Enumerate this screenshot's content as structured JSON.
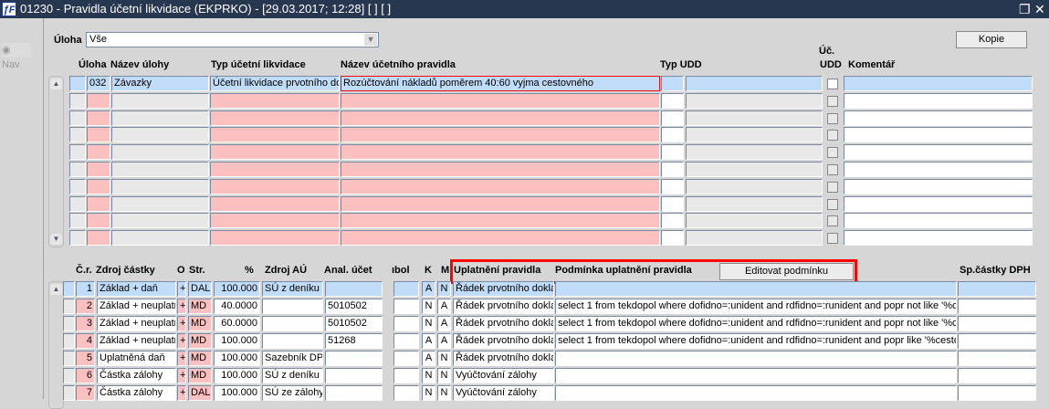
{
  "window": {
    "title": "01230 - Pravidla účetní likvidace (EKPRKO) - [29.03.2017; 12:28]  [ ] [ ]",
    "logo": "TF",
    "restore_icon": "restore-icon",
    "close_icon": "close-icon"
  },
  "nav": {
    "label": "Nav"
  },
  "filter": {
    "label": "Úloha",
    "value": "Vše"
  },
  "kopie_button": "Kopie",
  "top_grid": {
    "headers": {
      "uloha": "Úloha",
      "nazev_ulohy": "Název úlohy",
      "typ": "Typ účetní likvidace",
      "nazev_pravidla": "Název účetního pravidla",
      "typ_udd": "Typ UDD",
      "uc_udd_1": "Úč.",
      "uc_udd_2": "UDD",
      "komentar": "Komentář"
    },
    "rows": [
      {
        "uloha": "032",
        "nazev_ulohy": "Závazky",
        "typ": "Účetní likvidace prvotního do",
        "nazev_pravidla": "Rozúčtování nákladů poměrem 40:60 vyjma cestovného",
        "typ_udd": "",
        "typ_udd_name": "",
        "uc_udd": false,
        "komentar": ""
      }
    ],
    "empty_rows": 9
  },
  "bottom_grid": {
    "headers": {
      "cr": "Č.r.",
      "zdroj": "Zdroj částky",
      "o": "O",
      "str": "Str.",
      "pct": "%",
      "zdroj_au": "Zdroj AÚ",
      "anal": "Anal. účet",
      "symbol": "ıbol",
      "k": "K",
      "m": "M",
      "uplatneni": "Uplatnění pravidla",
      "podminka": "Podmínka uplatnění pravidla",
      "sp": "Sp.částky DPH"
    },
    "edit_button": "Editovat podmínku",
    "rows": [
      {
        "cr": "1",
        "zdroj": "Základ + daň",
        "o": "+",
        "str": "DAL",
        "pct": "100.000",
        "zdroj_au": "SÚ z deníku",
        "anal": "",
        "k": "A",
        "m": "N",
        "uplatneni": "Řádek prvotního dokla",
        "podminka": ""
      },
      {
        "cr": "2",
        "zdroj": "Základ + neuplatr",
        "o": "+",
        "str": "MD",
        "pct": "40.0000",
        "zdroj_au": "",
        "anal": "5010502",
        "k": "N",
        "m": "A",
        "uplatneni": "Řádek prvotního dokla",
        "podminka": "select 1 from tekdopol where dofidno=:unident and rdfidno=:runident and popr not like '%ce"
      },
      {
        "cr": "3",
        "zdroj": "Základ + neuplatr",
        "o": "+",
        "str": "MD",
        "pct": "60.0000",
        "zdroj_au": "",
        "anal": "5010502",
        "k": "N",
        "m": "A",
        "uplatneni": "Řádek prvotního dokla",
        "podminka": "select 1 from tekdopol where dofidno=:unident and rdfidno=:runident and popr not like '%ce"
      },
      {
        "cr": "4",
        "zdroj": "Základ + neuplatr",
        "o": "+",
        "str": "MD",
        "pct": "100.000",
        "zdroj_au": "",
        "anal": "51268",
        "k": "A",
        "m": "A",
        "uplatneni": "Řádek prvotního dokla",
        "podminka": "select 1 from tekdopol where dofidno=:unident and rdfidno=:runident and popr like '%cesto"
      },
      {
        "cr": "5",
        "zdroj": "Uplatněná daň",
        "o": "+",
        "str": "MD",
        "pct": "100.000",
        "zdroj_au": "Sazebník DPH",
        "anal": "",
        "k": "A",
        "m": "N",
        "uplatneni": "Řádek prvotního dokla",
        "podminka": ""
      },
      {
        "cr": "6",
        "zdroj": "Částka zálohy",
        "o": "+",
        "str": "MD",
        "pct": "100.000",
        "zdroj_au": "SÚ z deníku",
        "anal": "",
        "k": "N",
        "m": "N",
        "uplatneni": "Vyúčtování zálohy",
        "podminka": ""
      },
      {
        "cr": "7",
        "zdroj": "Částka zálohy",
        "o": "+",
        "str": "DAL",
        "pct": "100.000",
        "zdroj_au": "SÚ ze zálohy",
        "anal": "",
        "k": "N",
        "m": "N",
        "uplatneni": "Vyúčtování zálohy",
        "podminka": ""
      }
    ]
  }
}
